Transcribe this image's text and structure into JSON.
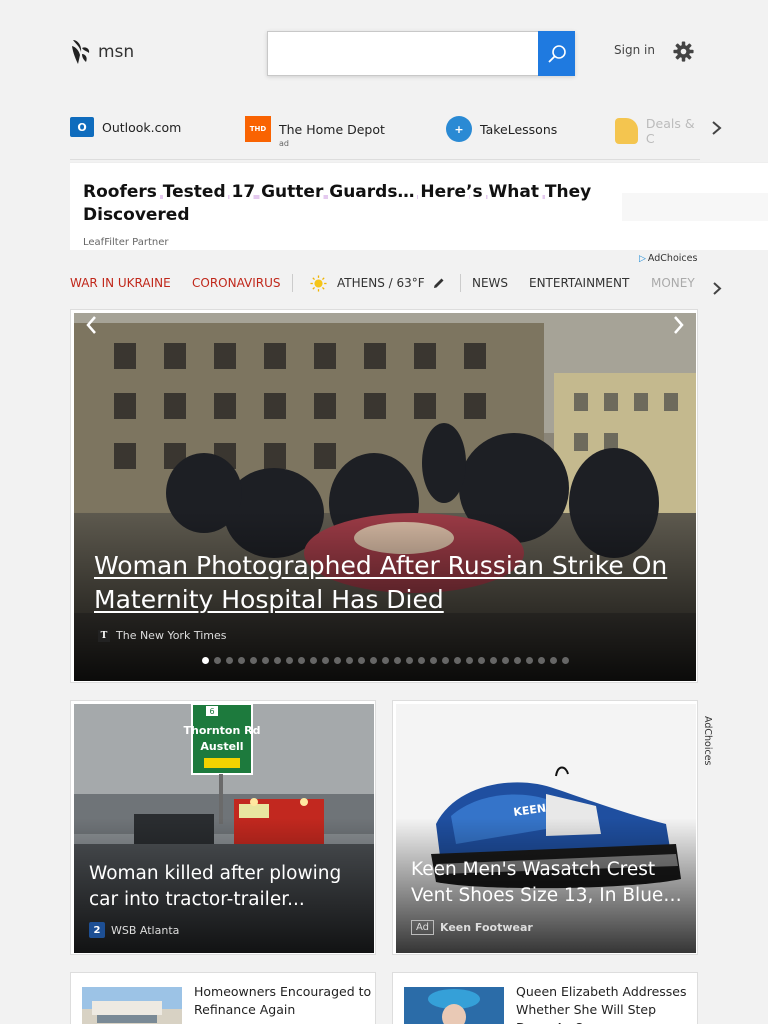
{
  "header": {
    "logo_text": "msn",
    "search_placeholder": "",
    "signin_label": "Sign in"
  },
  "quicklinks": [
    {
      "label": "Outlook.com",
      "sub": ""
    },
    {
      "label": "The Home Depot",
      "sub": "ad"
    },
    {
      "label": "TakeLessons",
      "sub": ""
    },
    {
      "label": "Deals & C",
      "sub": ""
    }
  ],
  "ad_banner": {
    "title": "Roofers Tested 17 Gutter Guards… Here’s What They Discovered",
    "source": "LeafFilter Partner",
    "adchoices": "AdChoices"
  },
  "nav": {
    "items": [
      "WAR IN UKRAINE",
      "CORONAVIRUS",
      "ATHENS / 63°F",
      "NEWS",
      "ENTERTAINMENT",
      "MONEY"
    ]
  },
  "hero": {
    "title": "Woman Photographed After Russian Strike On Maternity Hospital Has Died",
    "source": "The New York Times",
    "slide_count": 31,
    "active_slide": 1
  },
  "cards": [
    {
      "title": "Woman killed after plowing car into tractor-trailer...",
      "source": "WSB Atlanta",
      "sign_line1": "Thornton Rd",
      "sign_line2": "Austell",
      "sign_number": "6"
    },
    {
      "title": "Keen Men's Wasatch Crest Vent Shoes Size 13, In Blue…",
      "source": "Keen Footwear",
      "ad_label": "Ad",
      "shoe_brand": "KEEN"
    }
  ],
  "side_adchoices": "AdChoices",
  "bottom": [
    {
      "title": "Homeowners Encouraged to Refinance Again"
    },
    {
      "title": "Queen Elizabeth Addresses Whether She Will Step Down As Queen"
    }
  ],
  "colors": {
    "search_button": "#1f7ae0",
    "nav_red": "#c0271a",
    "outlook": "#0f6cbd",
    "home_depot": "#f96302",
    "takelessons": "#2a8ad4"
  }
}
